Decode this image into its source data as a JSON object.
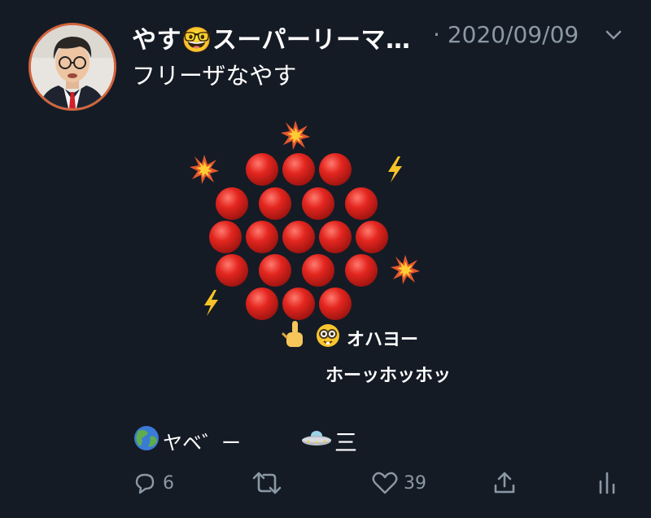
{
  "tweet": {
    "author_name": "やす🤓スーパーリーマ…",
    "separator": "·",
    "date": "2020/09/09",
    "text": "フリーザなやす"
  },
  "art": {
    "caption_line1": "オハヨー",
    "caption_line2": "ホーッホッホッ",
    "bottom_left_text": "ヤベ゛ー",
    "bottom_right_text": "三"
  },
  "actions": {
    "reply_count": "6",
    "like_count": "39"
  },
  "colors": {
    "background": "#151b25",
    "muted": "#8b98a5",
    "ball": "#d3201c",
    "avatar_ring": "#d2643c"
  },
  "icons": [
    "avatar",
    "chevron-down-icon",
    "reply-icon",
    "retweet-icon",
    "like-icon",
    "share-icon",
    "analytics-icon",
    "collision-icon",
    "lightning-icon",
    "pointing-finger-icon",
    "nerd-face-icon",
    "globe-icon",
    "ufo-icon"
  ]
}
